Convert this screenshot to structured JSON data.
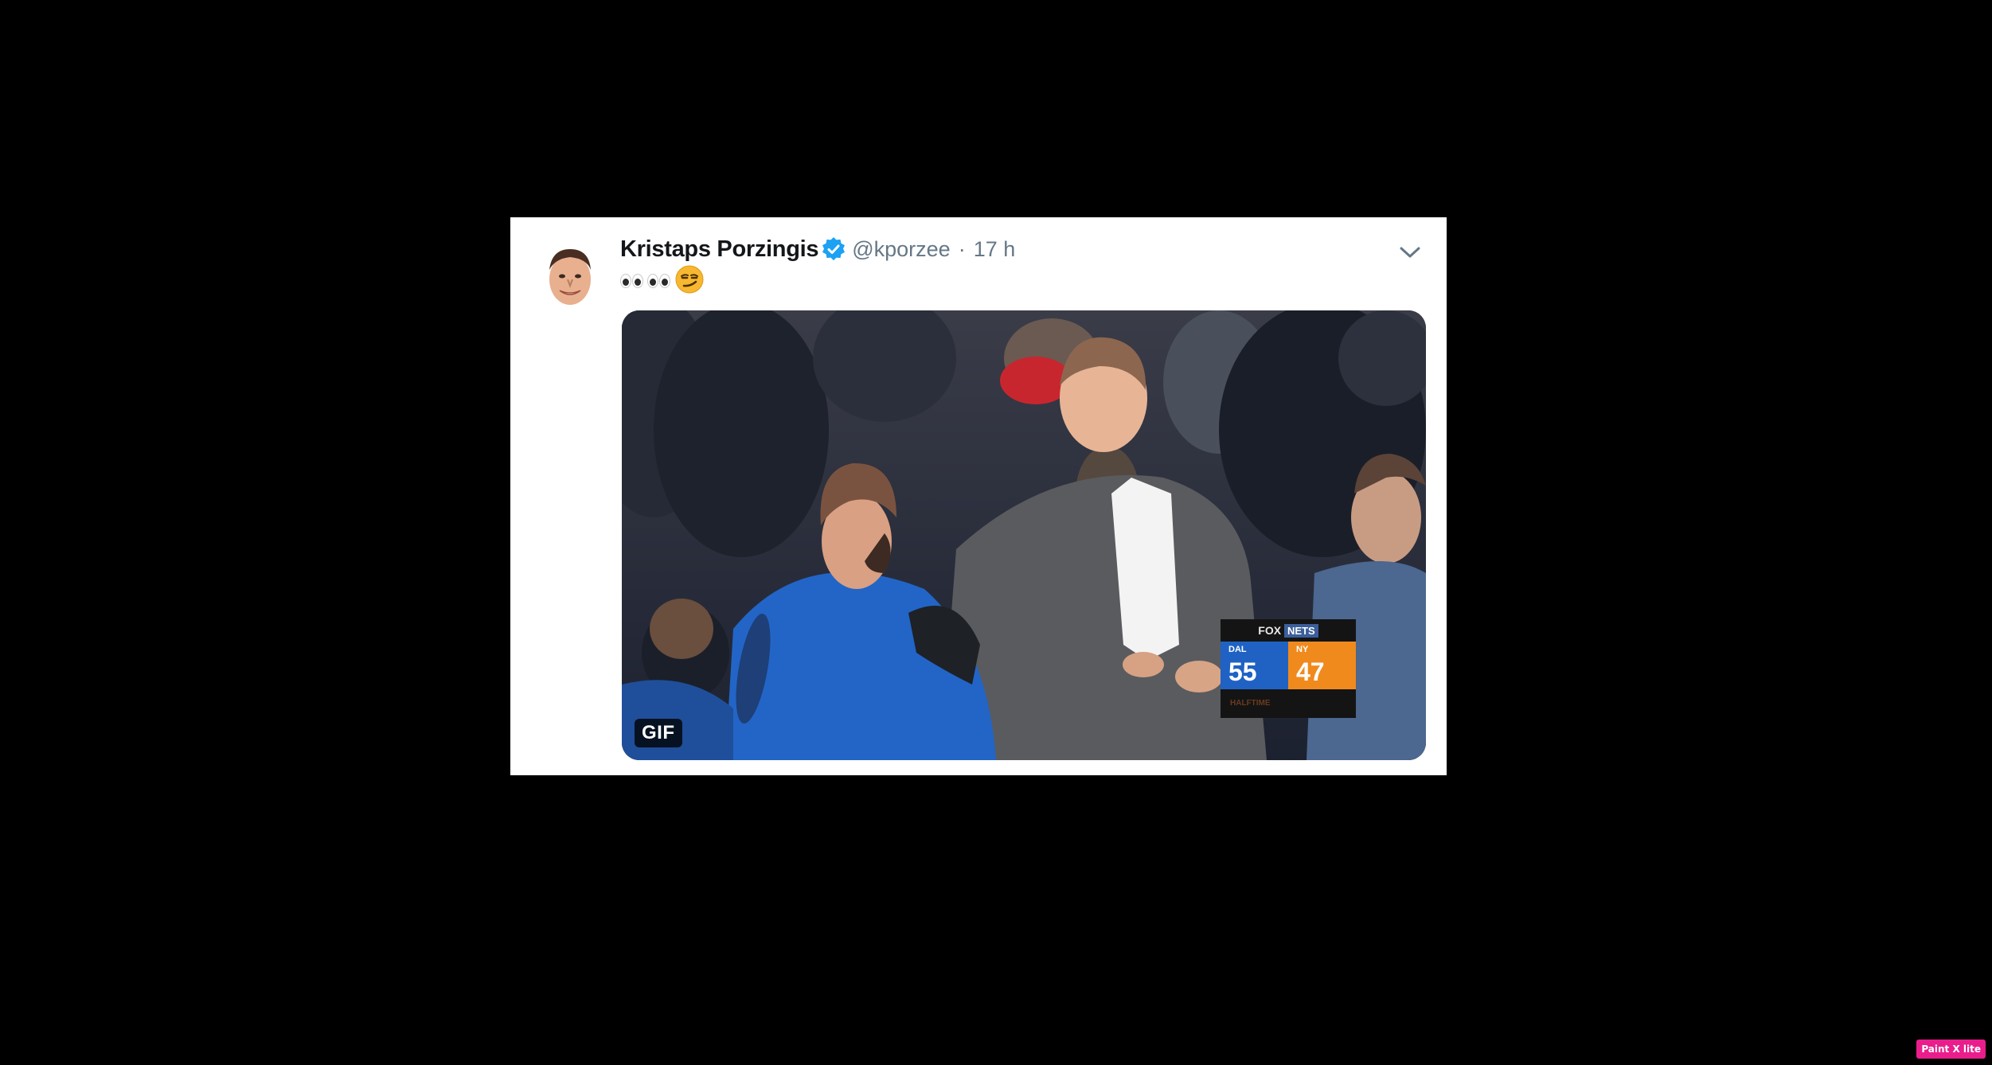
{
  "tweet": {
    "display_name": "Kristaps Porzingis",
    "handle": "@kporzee",
    "separator": "·",
    "timestamp": "17 h",
    "verified": true,
    "text_emojis": [
      "eyes-emoji",
      "eyes-emoji",
      "smirking-face-emoji"
    ],
    "media": {
      "badge": "GIF",
      "scoreboard": {
        "network": "FOX",
        "network_channel": "NETS",
        "away_team": "DAL",
        "away_score": "55",
        "home_team": "NY",
        "home_score": "47",
        "status": "HALFTIME"
      }
    }
  },
  "overlay": {
    "app_badge": "Paint X lite"
  },
  "colors": {
    "background": "#000000",
    "card": "#ffffff",
    "name": "#14171a",
    "secondary": "#657786",
    "verified": "#1da1f2",
    "dal_blue": "#1f62c4",
    "ny_orange": "#f08a1d"
  }
}
